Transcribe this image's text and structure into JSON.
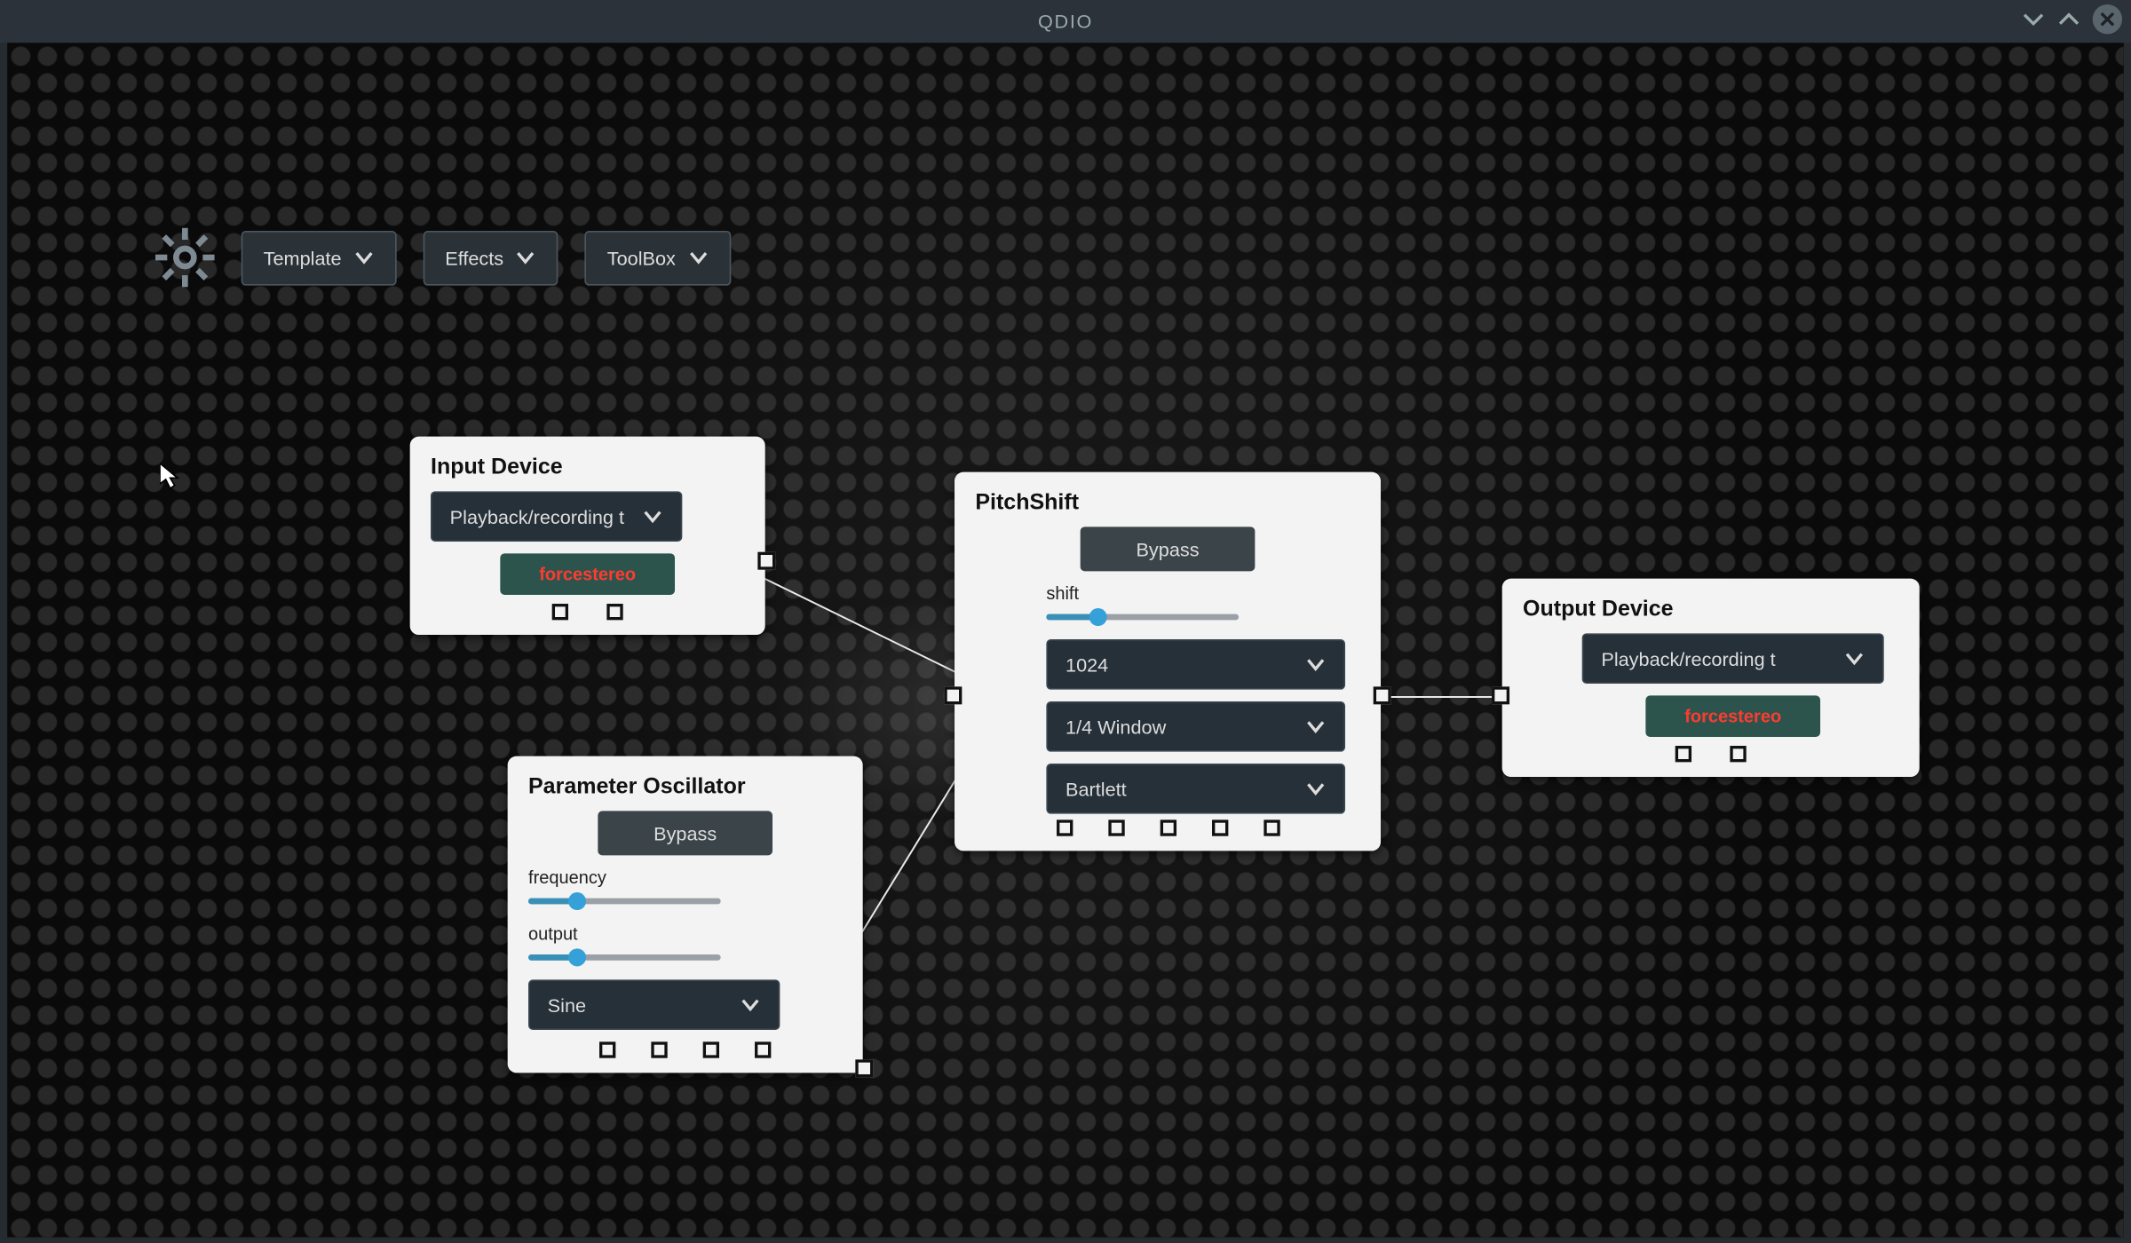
{
  "app": {
    "title": "QDIO"
  },
  "toolbar": {
    "template_label": "Template",
    "effects_label": "Effects",
    "toolbox_label": "ToolBox"
  },
  "nodes": {
    "input_device": {
      "title": "Input Device",
      "select_label": "Playback/recording t",
      "forcestereo_label": "forcestereo"
    },
    "param_osc": {
      "title": "Parameter Oscillator",
      "bypass_label": "Bypass",
      "freq_label": "frequency",
      "freq_value_pct": 25,
      "output_label": "output",
      "output_value_pct": 25,
      "wave_label": "Sine"
    },
    "pitch_shift": {
      "title": "PitchShift",
      "bypass_label": "Bypass",
      "shift_label": "shift",
      "shift_value_pct": 27,
      "fft_label": "1024",
      "window_label": "1/4 Window",
      "window_type_label": "Bartlett"
    },
    "output_device": {
      "title": "Output Device",
      "select_label": "Playback/recording t",
      "forcestereo_label": "forcestereo"
    }
  }
}
